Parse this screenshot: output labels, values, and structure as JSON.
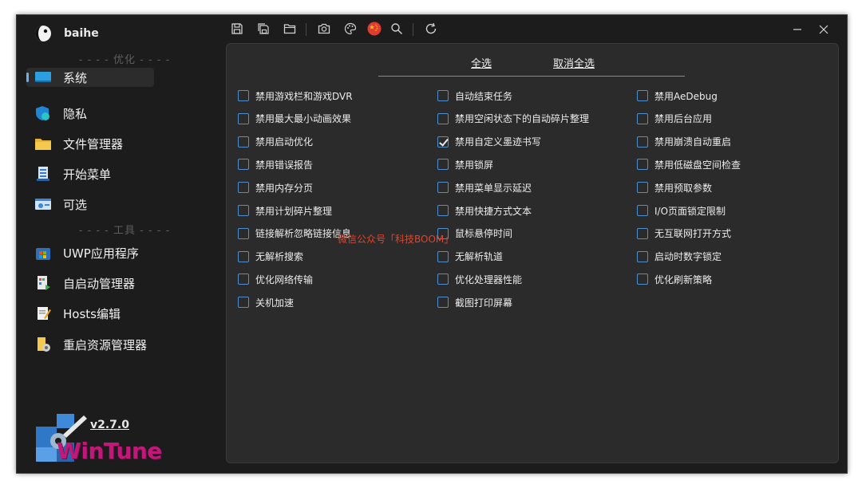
{
  "app": {
    "user": "baihe",
    "version": "v2.7.0",
    "logo_text": "WinTune"
  },
  "sidebar": {
    "sections": [
      {
        "title": "- - - - 优化 - - - -"
      },
      {
        "title": "- - - - 工具 - - - -"
      }
    ],
    "items": [
      {
        "label": "系统",
        "icon": "monitor-icon"
      },
      {
        "label": "隐私",
        "icon": "shield-icon"
      },
      {
        "label": "文件管理器",
        "icon": "folder-icon"
      },
      {
        "label": "开始菜单",
        "icon": "start-menu-icon"
      },
      {
        "label": "可选",
        "icon": "options-icon"
      },
      {
        "label": "UWP应用程序",
        "icon": "uwp-apps-icon"
      },
      {
        "label": "自启动管理器",
        "icon": "startup-manager-icon"
      },
      {
        "label": "Hosts编辑",
        "icon": "hosts-edit-icon"
      },
      {
        "label": "重启资源管理器",
        "icon": "restart-explorer-icon"
      }
    ]
  },
  "toolbar": {
    "icons": [
      "save-icon",
      "save-all-icon",
      "open-folder-icon",
      "camera-icon",
      "palette-icon",
      "china-flag-icon",
      "search-icon",
      "refresh-icon"
    ]
  },
  "main": {
    "select_all": "全选",
    "deselect_all": "取消全选",
    "columns": [
      [
        {
          "label": "禁用游戏栏和游戏DVR",
          "checked": false
        },
        {
          "label": "禁用最大最小动画效果",
          "checked": false
        },
        {
          "label": "禁用启动优化",
          "checked": false
        },
        {
          "label": "禁用错误报告",
          "checked": false
        },
        {
          "label": "禁用内存分页",
          "checked": false
        },
        {
          "label": "禁用计划碎片整理",
          "checked": false
        },
        {
          "label": "链接解析忽略链接信息",
          "checked": false
        },
        {
          "label": "无解析搜索",
          "checked": false
        },
        {
          "label": "优化网络传输",
          "checked": false
        },
        {
          "label": "关机加速",
          "checked": false
        }
      ],
      [
        {
          "label": "自动结束任务",
          "checked": false
        },
        {
          "label": "禁用空闲状态下的自动碎片整理",
          "checked": false
        },
        {
          "label": "禁用自定义墨迹书写",
          "checked": true
        },
        {
          "label": "禁用锁屏",
          "checked": false
        },
        {
          "label": "禁用菜单显示延迟",
          "checked": false
        },
        {
          "label": "禁用快捷方式文本",
          "checked": false
        },
        {
          "label": "鼠标悬停时间",
          "checked": false
        },
        {
          "label": "无解析轨道",
          "checked": false
        },
        {
          "label": "优化处理器性能",
          "checked": false
        },
        {
          "label": "截图打印屏幕",
          "checked": false
        }
      ],
      [
        {
          "label": "禁用AeDebug",
          "checked": false
        },
        {
          "label": "禁用后台应用",
          "checked": false
        },
        {
          "label": "禁用崩溃自动重启",
          "checked": false
        },
        {
          "label": "禁用低磁盘空间检查",
          "checked": false
        },
        {
          "label": "禁用预取参数",
          "checked": false
        },
        {
          "label": "I/O页面锁定限制",
          "checked": false
        },
        {
          "label": "无互联网打开方式",
          "checked": false
        },
        {
          "label": "启动时数字锁定",
          "checked": false
        },
        {
          "label": "优化刷新策略",
          "checked": false
        }
      ]
    ],
    "watermark": "微信公众号「科技BOOM」"
  },
  "colors": {
    "window_bg": "#1c1c1c",
    "panel_bg": "#2b2b2b",
    "accent": "#4f8fcf",
    "watermark": "#e0452d"
  }
}
